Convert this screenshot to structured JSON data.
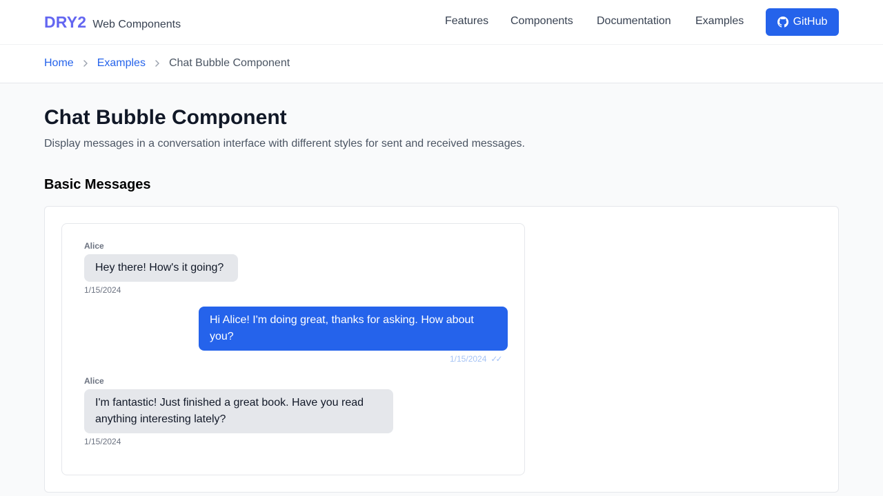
{
  "header": {
    "logo": "DRY2",
    "subtitle": "Web Components",
    "nav": [
      "Features",
      "Components",
      "Documentation",
      "Examples"
    ],
    "github_label": "GitHub"
  },
  "breadcrumb": {
    "home": "Home",
    "examples": "Examples",
    "current": "Chat Bubble Component"
  },
  "main": {
    "title": "Chat Bubble Component",
    "description": "Display messages in a conversation interface with different styles for sent and received messages.",
    "section_title": "Basic Messages"
  },
  "messages": [
    {
      "direction": "received",
      "sender": "Alice",
      "text": "Hey there! How's it going?",
      "timestamp": "1/15/2024"
    },
    {
      "direction": "sent",
      "text": "Hi Alice! I'm doing great, thanks for asking. How about you?",
      "timestamp": "1/15/2024",
      "status_icon": "double-check-icon"
    },
    {
      "direction": "received",
      "sender": "Alice",
      "text": "I'm fantastic! Just finished a great book. Have you read anything interesting lately?",
      "timestamp": "1/15/2024"
    }
  ],
  "colors": {
    "brand": "#6366f1",
    "accent": "#2563eb",
    "received_bubble": "#e5e7eb",
    "page_background": "#f9fafb"
  }
}
